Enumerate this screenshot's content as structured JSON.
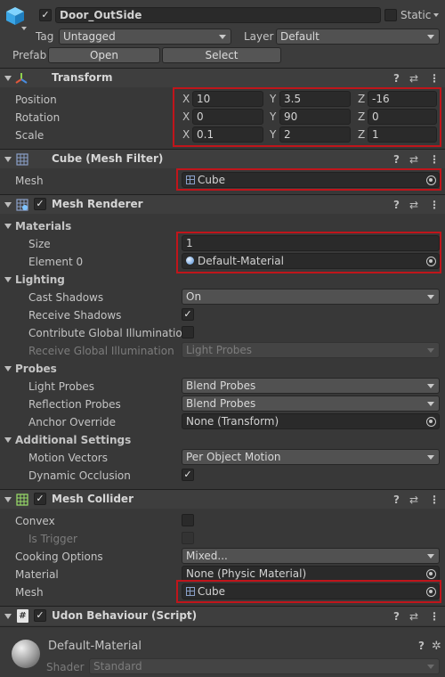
{
  "object": {
    "name": "Door_OutSide",
    "static_label": "Static",
    "tag_label": "Tag",
    "tag_value": "Untagged",
    "layer_label": "Layer",
    "layer_value": "Default",
    "prefab_label": "Prefab",
    "open_label": "Open",
    "select_label": "Select"
  },
  "transform": {
    "title": "Transform",
    "rows": [
      {
        "label": "Position",
        "x": "10",
        "y": "3.5",
        "z": "-16"
      },
      {
        "label": "Rotation",
        "x": "0",
        "y": "90",
        "z": "0"
      },
      {
        "label": "Scale",
        "x": "0.1",
        "y": "2",
        "z": "1"
      }
    ],
    "axis": {
      "x": "X",
      "y": "Y",
      "z": "Z"
    }
  },
  "mesh_filter": {
    "title": "Cube (Mesh Filter)",
    "mesh_label": "Mesh",
    "mesh_value": "Cube"
  },
  "mesh_renderer": {
    "title": "Mesh Renderer",
    "materials_label": "Materials",
    "size_label": "Size",
    "size_value": "1",
    "element0_label": "Element 0",
    "element0_value": "Default-Material",
    "lighting_label": "Lighting",
    "cast_shadows_label": "Cast Shadows",
    "cast_shadows_value": "On",
    "receive_shadows_label": "Receive Shadows",
    "contribute_gi_label": "Contribute Global Illumination",
    "receive_gi_label": "Receive Global Illumination",
    "receive_gi_value": "Light Probes",
    "probes_label": "Probes",
    "light_probes_label": "Light Probes",
    "light_probes_value": "Blend Probes",
    "reflection_probes_label": "Reflection Probes",
    "reflection_probes_value": "Blend Probes",
    "anchor_override_label": "Anchor Override",
    "anchor_override_value": "None (Transform)",
    "additional_label": "Additional Settings",
    "motion_vectors_label": "Motion Vectors",
    "motion_vectors_value": "Per Object Motion",
    "dynamic_occlusion_label": "Dynamic Occlusion"
  },
  "mesh_collider": {
    "title": "Mesh Collider",
    "convex_label": "Convex",
    "is_trigger_label": "Is Trigger",
    "cooking_label": "Cooking Options",
    "cooking_value": "Mixed...",
    "material_label": "Material",
    "material_value": "None (Physic Material)",
    "mesh_label": "Mesh",
    "mesh_value": "Cube"
  },
  "udon": {
    "title": "Udon Behaviour (Script)"
  },
  "material_footer": {
    "name": "Default-Material",
    "shader_label": "Shader",
    "shader_value": "Standard"
  },
  "icons": {
    "check": "✓",
    "help": "?",
    "settings": "⇄",
    "menu": "⋮"
  },
  "colors": {
    "highlight_box": "#c0151b",
    "background": "#383838"
  }
}
